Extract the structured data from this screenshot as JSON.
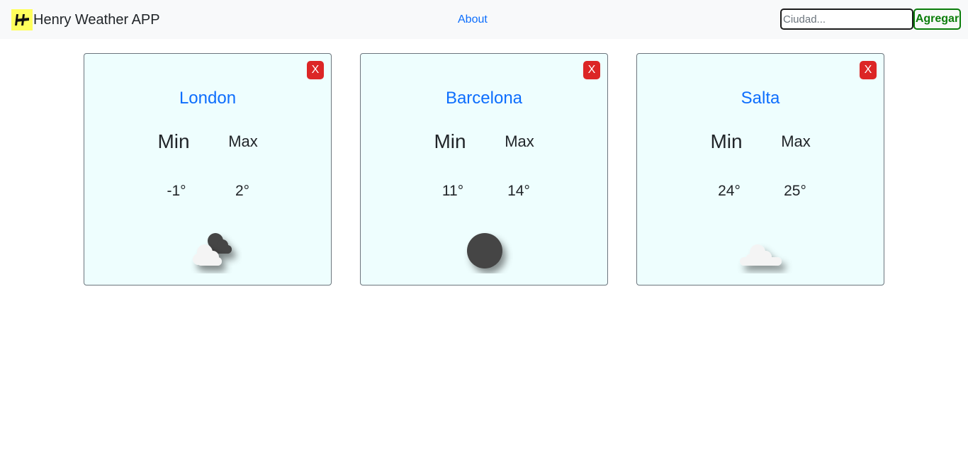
{
  "header": {
    "brand": "Henry Weather APP",
    "about_label": "About",
    "search_placeholder": "Ciudad...",
    "search_value": "",
    "add_label": "Agregar"
  },
  "colors": {
    "navbar_bg": "#f8f9fa",
    "logo_bg": "#ffff5c",
    "link": "#0d6efd",
    "add_button": "#0a7d0a",
    "close_button": "#dc2626",
    "card_bg": "#eefefe"
  },
  "cards": [
    {
      "city": "London",
      "close_label": "X",
      "min_label": "Min",
      "max_label": "Max",
      "min": "-1°",
      "max": "2°",
      "icon": "broken-clouds-icon"
    },
    {
      "city": "Barcelona",
      "close_label": "X",
      "min_label": "Min",
      "max_label": "Max",
      "min": "11°",
      "max": "14°",
      "icon": "clear-night-moon-icon"
    },
    {
      "city": "Salta",
      "close_label": "X",
      "min_label": "Min",
      "max_label": "Max",
      "min": "24°",
      "max": "25°",
      "icon": "cloud-icon"
    }
  ]
}
